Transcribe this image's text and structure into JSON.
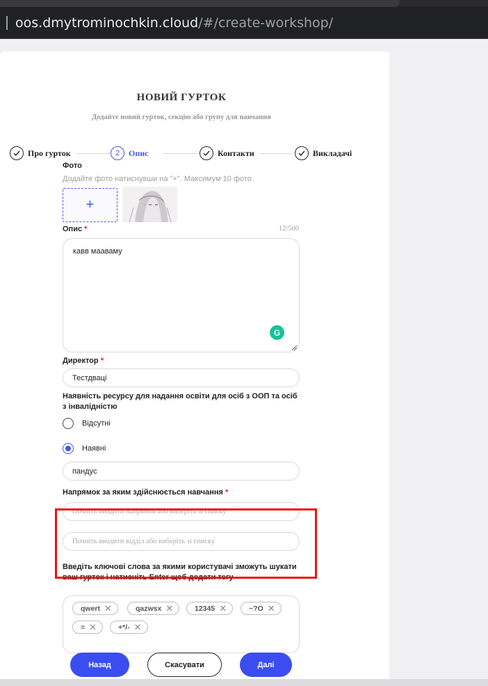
{
  "browser": {
    "url_host": "oos.dmytrominochkin.cloud",
    "url_path": "/#/create-workshop/"
  },
  "header": {
    "title": "НОВИЙ ГУРТОК",
    "subtitle": "Додайте новий гурток, секцію або групу для навчання"
  },
  "stepper": {
    "steps": [
      {
        "label": "Про гурток",
        "state": "done",
        "number": ""
      },
      {
        "label": "Опис",
        "state": "active",
        "number": "2"
      },
      {
        "label": "Контакти",
        "state": "done",
        "number": ""
      },
      {
        "label": "Викладачі",
        "state": "done",
        "number": ""
      }
    ]
  },
  "photo": {
    "label": "Фото",
    "hint": "Додайте фото натиснувши на \"+\". Максимум 10 фото",
    "add_symbol": "+"
  },
  "description": {
    "label": "Опис",
    "required_mark": "*",
    "counter": "12/500",
    "value": "кавв мааваму",
    "grammarly_glyph": "G"
  },
  "director": {
    "label": "Директор",
    "required_mark": "*",
    "value": "Тестдваці"
  },
  "accessibility": {
    "label": "Наявність ресурсу для надання освіти для осіб з ООП та осіб з інвалідністю",
    "options": [
      {
        "label": "Відсутні",
        "checked": false
      },
      {
        "label": "Наявні",
        "checked": true
      }
    ],
    "details_value": "пандус"
  },
  "direction": {
    "label": "Напрямок за яким здійснюється навчання",
    "required_mark": "*",
    "direction_placeholder": "Почніть вводити напрямок або виберіть зі списку",
    "department_placeholder": "Почніть вводити відділ або виберіть зі списку"
  },
  "keywords": {
    "label": "Введіть ключові слова за якими користувачі зможуть шукати ваш гурток і натисніть Enter щоб додати тегу",
    "tags": [
      "qwert",
      "qazwsx",
      "12345",
      "~?O",
      "=",
      "+*/-"
    ]
  },
  "actions": {
    "back_label": "Назад",
    "cancel_label": "Скасувати",
    "next_label": "Далі"
  },
  "colors": {
    "accent": "#3b4df0",
    "required": "#e01e1e",
    "highlight": "#ee1111"
  }
}
